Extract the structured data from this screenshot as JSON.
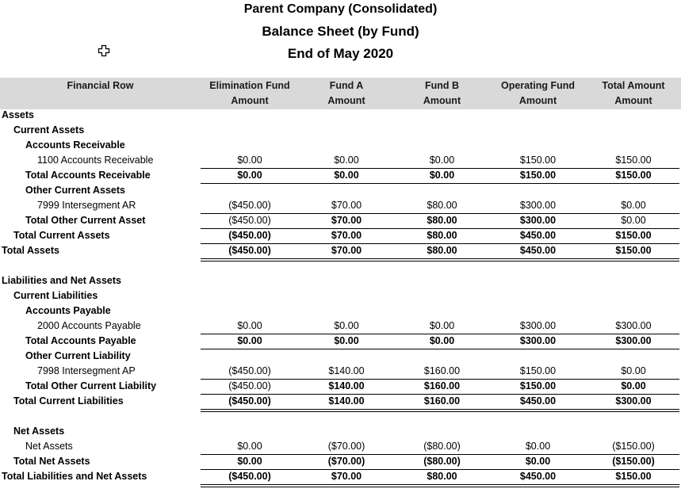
{
  "report": {
    "company": "Parent Company (Consolidated)",
    "title": "Balance Sheet (by Fund)",
    "period": "End of May 2020"
  },
  "columns": [
    {
      "line1": "Financial Row",
      "line2": ""
    },
    {
      "line1": "Elimination Fund",
      "line2": "Amount"
    },
    {
      "line1": "Fund A",
      "line2": "Amount"
    },
    {
      "line1": "Fund B",
      "line2": "Amount"
    },
    {
      "line1": "Operating Fund",
      "line2": "Amount"
    },
    {
      "line1": "Total Amount",
      "line2": "Amount"
    }
  ],
  "rows": [
    {
      "label": "Assets",
      "level": 0,
      "bold": true,
      "values": []
    },
    {
      "label": "Current Assets",
      "level": 1,
      "bold": true,
      "values": []
    },
    {
      "label": "Accounts Receivable",
      "level": 2,
      "bold": true,
      "values": []
    },
    {
      "label": "1100 Accounts Receivable",
      "level": 3,
      "bold": false,
      "values": [
        "$0.00",
        "$0.00",
        "$0.00",
        "$150.00",
        "$150.00"
      ]
    },
    {
      "label": "Total Accounts Receivable",
      "level": 2,
      "bold": true,
      "values": [
        "$0.00",
        "$0.00",
        "$0.00",
        "$150.00",
        "$150.00"
      ]
    },
    {
      "label": "Other Current Assets",
      "level": 2,
      "bold": true,
      "values": []
    },
    {
      "label": "7999 Intersegment AR",
      "level": 3,
      "bold": false,
      "values": [
        "($450.00)",
        "$70.00",
        "$80.00",
        "$300.00",
        "$0.00"
      ]
    },
    {
      "label": "Total Other Current Asset",
      "level": 2,
      "bold": true,
      "values": [
        "($450.00)",
        "$70.00",
        "$80.00",
        "$300.00",
        "$0.00"
      ]
    },
    {
      "label": "Total Current Assets",
      "level": 1,
      "bold": true,
      "values": [
        "($450.00)",
        "$70.00",
        "$80.00",
        "$450.00",
        "$150.00"
      ]
    },
    {
      "label": "Total Assets",
      "level": 0,
      "bold": true,
      "values": [
        "($450.00)",
        "$70.00",
        "$80.00",
        "$450.00",
        "$150.00"
      ]
    },
    {
      "label": "",
      "level": 0,
      "bold": false,
      "values": []
    },
    {
      "label": "Liabilities and Net Assets",
      "level": 0,
      "bold": true,
      "values": []
    },
    {
      "label": "Current Liabilities",
      "level": 1,
      "bold": true,
      "values": []
    },
    {
      "label": "Accounts Payable",
      "level": 2,
      "bold": true,
      "values": []
    },
    {
      "label": "2000 Accounts Payable",
      "level": 3,
      "bold": false,
      "values": [
        "$0.00",
        "$0.00",
        "$0.00",
        "$300.00",
        "$300.00"
      ]
    },
    {
      "label": "Total Accounts Payable",
      "level": 2,
      "bold": true,
      "values": [
        "$0.00",
        "$0.00",
        "$0.00",
        "$300.00",
        "$300.00"
      ]
    },
    {
      "label": "Other Current Liability",
      "level": 2,
      "bold": true,
      "values": []
    },
    {
      "label": "7998 Intersegment AP",
      "level": 3,
      "bold": false,
      "values": [
        "($450.00)",
        "$140.00",
        "$160.00",
        "$150.00",
        "$0.00"
      ]
    },
    {
      "label": "Total Other Current Liability",
      "level": 2,
      "bold": true,
      "values": [
        "($450.00)",
        "$140.00",
        "$160.00",
        "$150.00",
        "$0.00"
      ]
    },
    {
      "label": "Total Current Liabilities",
      "level": 1,
      "bold": true,
      "values": [
        "($450.00)",
        "$140.00",
        "$160.00",
        "$450.00",
        "$300.00"
      ]
    },
    {
      "label": "",
      "level": 0,
      "bold": false,
      "values": []
    },
    {
      "label": "Net Assets",
      "level": 1,
      "bold": true,
      "values": []
    },
    {
      "label": "Net Assets",
      "level": 2,
      "bold": false,
      "values": [
        "$0.00",
        "($70.00)",
        "($80.00)",
        "$0.00",
        "($150.00)"
      ]
    },
    {
      "label": "Total Net Assets",
      "level": 1,
      "bold": true,
      "values": [
        "$0.00",
        "($70.00)",
        "($80.00)",
        "$0.00",
        "($150.00)"
      ]
    },
    {
      "label": "Total Liabilities and Net Assets",
      "level": 0,
      "bold": true,
      "values": [
        "($450.00)",
        "$70.00",
        "$80.00",
        "$450.00",
        "$150.00"
      ]
    }
  ],
  "value_bold": {
    "7": [
      false,
      true,
      true,
      true,
      false
    ],
    "18": [
      false,
      true,
      true,
      true,
      true
    ]
  }
}
